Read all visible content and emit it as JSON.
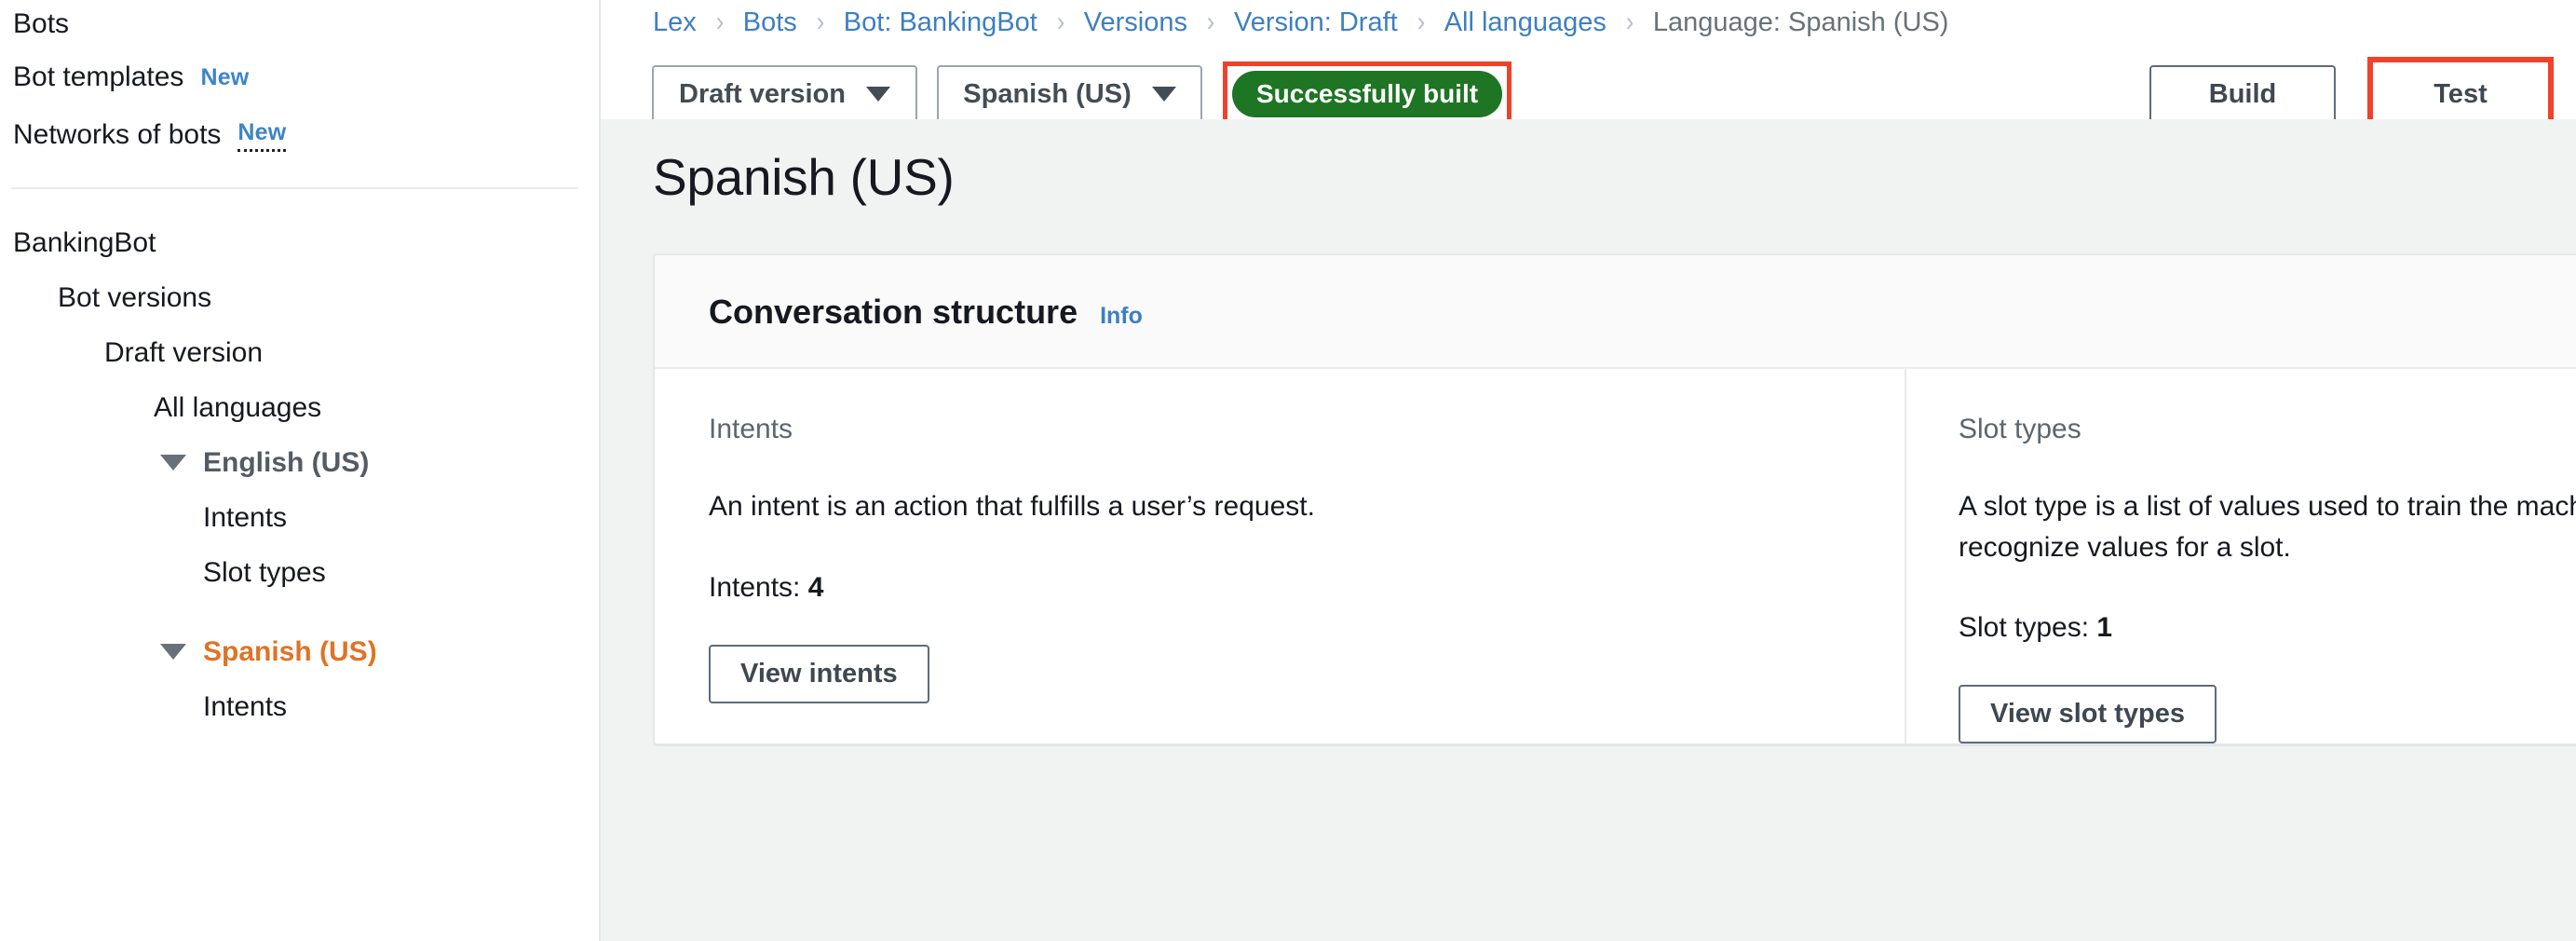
{
  "sidebar": {
    "top_links": [
      {
        "label": "Bots",
        "badge": null,
        "badge_dotted": false
      },
      {
        "label": "Bot templates",
        "badge": "New",
        "badge_dotted": false
      },
      {
        "label": "Networks of bots",
        "badge": "New",
        "badge_dotted": true
      }
    ],
    "tree": [
      {
        "label": "BankingBot",
        "level": 0,
        "caret": false,
        "style": "plain"
      },
      {
        "label": "Bot versions",
        "level": 1,
        "caret": false,
        "style": "plain"
      },
      {
        "label": "Draft version",
        "level": 2,
        "caret": false,
        "style": "plain"
      },
      {
        "label": "All languages",
        "level": 3,
        "caret": false,
        "style": "plain"
      },
      {
        "label": "English (US)",
        "level": 3,
        "caret": true,
        "style": "lang-en"
      },
      {
        "label": "Intents",
        "level": 4,
        "caret": false,
        "style": "plain"
      },
      {
        "label": "Slot types",
        "level": 4,
        "caret": false,
        "style": "plain"
      },
      {
        "label": "Spanish (US)",
        "level": 3,
        "caret": true,
        "style": "lang-es"
      },
      {
        "label": "Intents",
        "level": 4,
        "caret": false,
        "style": "plain"
      }
    ]
  },
  "breadcrumb": {
    "separator": "›",
    "items": [
      {
        "label": "Lex",
        "current": false
      },
      {
        "label": "Bots",
        "current": false
      },
      {
        "label": "Bot: BankingBot",
        "current": false
      },
      {
        "label": "Versions",
        "current": false
      },
      {
        "label": "Version: Draft",
        "current": false
      },
      {
        "label": "All languages",
        "current": false
      },
      {
        "label": "Language: Spanish (US)",
        "current": true
      }
    ]
  },
  "toolbar": {
    "version_dropdown": "Draft version",
    "language_dropdown": "Spanish (US)",
    "status_badge": "Successfully built",
    "build_button": "Build",
    "test_button": "Test"
  },
  "page": {
    "title": "Spanish (US)"
  },
  "card": {
    "title": "Conversation structure",
    "info_label": "Info",
    "columns": [
      {
        "label": "Intents",
        "description": "An intent is an action that fulfills a user’s request.",
        "count_label": "Intents:",
        "count_value": "4",
        "button": "View intents"
      },
      {
        "label": "Slot types",
        "description": "A slot type is a list of values used to train the machine learning model to recognize values for a slot.",
        "count_label": "Slot types:",
        "count_value": "1",
        "button": "View slot types"
      }
    ]
  },
  "colors": {
    "link": "#3d7fc1",
    "accent_orange": "#df7326",
    "status_green": "#1e7524",
    "highlight_red": "#f0422a",
    "content_bg": "#f1f3f3"
  }
}
